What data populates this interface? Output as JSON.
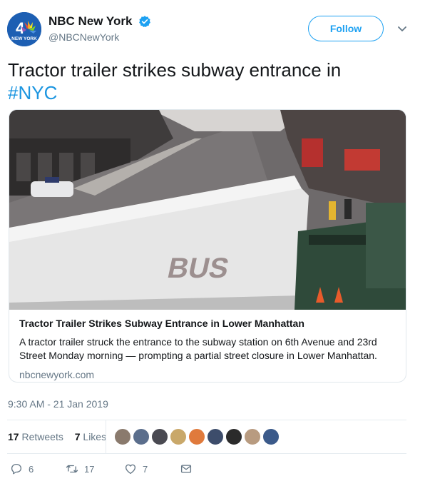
{
  "account": {
    "display_name": "NBC New York",
    "handle": "@NBCNewYork",
    "verified_icon": "verified-badge-icon",
    "avatar_text": "NEW YORK"
  },
  "follow_label": "Follow",
  "tweet": {
    "text": "Tractor trailer strikes subway entrance in",
    "hashtag": "#NYC"
  },
  "card": {
    "title": "Tractor Trailer Strikes Subway Entrance in Lower Manhattan",
    "description": "A tractor trailer struck the entrance to the subway station on 6th Avenue and 23rd Street Monday morning — prompting a partial street closure in Lower Manhattan.",
    "domain": "nbcnewyork.com"
  },
  "timestamp": "9:30 AM - 21 Jan 2019",
  "stats": {
    "retweets_count": "17",
    "retweets_label": "Retweets",
    "likes_count": "7",
    "likes_label": "Likes"
  },
  "likers": [
    "#8a7a6d",
    "#5b6e8c",
    "#4a4a52",
    "#c9a86a",
    "#e07a3c",
    "#3d4d6b",
    "#2b2b2b",
    "#b89b80",
    "#3b5a8a"
  ],
  "actions": {
    "reply_count": "6",
    "retweet_count": "17",
    "like_count": "7"
  },
  "colors": {
    "accent": "#1da1f2",
    "hashtag": "#1b95e0",
    "muted": "#657786"
  }
}
